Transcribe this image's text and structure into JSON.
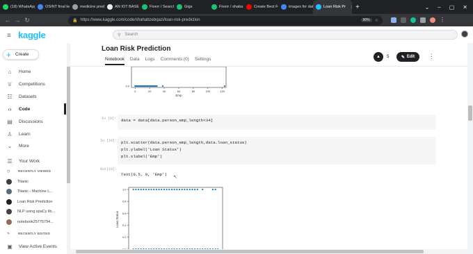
{
  "browser": {
    "tabs": [
      {
        "label": "(18) WhatsApp",
        "color": "#25d366"
      },
      {
        "label": "OSINT final kedaa",
        "color": "#4285f4"
      },
      {
        "label": "medicine pred",
        "color": "#9aa0a6"
      },
      {
        "label": "AN IOT BASED",
        "color": "#e8eaed"
      },
      {
        "label": "Fiverr / Search",
        "color": "#1dbf73"
      },
      {
        "label": "Gigs",
        "color": "#1dbf73"
      },
      {
        "label": "Fiverr / shaba",
        "color": "#1dbf73"
      },
      {
        "label": "Create Best Fo",
        "color": "#ff0000"
      },
      {
        "label": "images for dat",
        "color": "#4285f4"
      },
      {
        "label": "Loan Risk Pr",
        "color": "#20beff",
        "active": true
      }
    ],
    "new_tab": "+",
    "url": "https://www.kaggle.com/code/shahabzebqazi/loan-risk-prediction",
    "zoom": "90%"
  },
  "header": {
    "logo": "kaggle",
    "search_placeholder": "Search"
  },
  "sidebar": {
    "create_label": "Create",
    "items": [
      {
        "label": "Home",
        "icon": "home-icon",
        "glyph": "⌂"
      },
      {
        "label": "Competitions",
        "icon": "trophy-icon",
        "glyph": "♕"
      },
      {
        "label": "Datasets",
        "icon": "database-icon",
        "glyph": "☷"
      },
      {
        "label": "Code",
        "icon": "code-icon",
        "glyph": "‹›",
        "active": true
      },
      {
        "label": "Discussions",
        "icon": "comments-icon",
        "glyph": "▤"
      },
      {
        "label": "Learn",
        "icon": "school-icon",
        "glyph": "♙"
      },
      {
        "label": "More",
        "icon": "chevron-down-icon",
        "glyph": "⌄"
      }
    ],
    "your_work": "Your Work",
    "recently_viewed_label": "RECENTLY VIEWED",
    "recently_viewed": [
      {
        "label": "Titanic",
        "color": "#3c4043"
      },
      {
        "label": "Titanic - Machine L...",
        "color": "#546e7a"
      },
      {
        "label": "Loan Risk Prediction",
        "color": "#202124"
      },
      {
        "label": "NLP using spaCy lib...",
        "color": "#424242"
      },
      {
        "label": "notebook25775794...",
        "color": "#8d6e63"
      }
    ],
    "recently_edited_label": "RECENTLY EDITED",
    "view_active_events": "View Active Events"
  },
  "notebook": {
    "title": "Loan Risk Prediction",
    "tabs": [
      "Notebook",
      "Data",
      "Logs",
      "Comments (0)",
      "Settings"
    ],
    "selected_tab": "Notebook",
    "vote_count": "5",
    "edit_label": "Edit",
    "cells": [
      {
        "prompt": "In [9]:",
        "code": "data = data[data.person_emp_length<34]"
      },
      {
        "prompt": "In [10]:",
        "code": "plt.scatter(data.person_emp_length,data.loan_status)\nplt.ylabel('Loan Status')\nplt.xlabel('Emp')"
      }
    ],
    "output": {
      "prompt": "Out[10]:",
      "text": "Text(0.5, 0, 'Emp')"
    }
  },
  "chart_data": [
    {
      "type": "scatter",
      "xlabel": "Emp",
      "ylabel": "",
      "x_ticks": [
        "0",
        "20",
        "40",
        "60",
        "80",
        "100",
        "120"
      ],
      "y_ticks": [
        "0.0"
      ],
      "xlim": [
        -5,
        125
      ],
      "ylim": [
        0,
        1
      ],
      "points_y0": [
        0,
        1,
        2,
        3,
        4,
        5,
        6,
        7,
        8,
        9,
        10,
        11,
        12,
        13,
        14,
        15,
        16,
        17,
        18,
        19,
        20,
        21,
        22,
        23,
        24,
        25,
        26,
        27,
        28,
        29,
        30,
        38,
        123
      ]
    },
    {
      "type": "scatter",
      "xlabel": "",
      "ylabel": "Loan Status",
      "y_ticks": [
        "1.0",
        "0.8",
        "0.6",
        "0.4",
        "0.2",
        "0.0"
      ],
      "ylim": [
        0,
        1
      ],
      "xlim": [
        -1,
        34
      ],
      "points_y1": [
        0,
        1,
        2,
        3,
        4,
        5,
        6,
        7,
        8,
        9,
        10,
        11,
        12,
        13,
        14,
        15,
        16,
        17,
        18,
        19,
        20,
        21,
        22,
        23,
        24,
        25,
        27,
        31,
        32
      ],
      "points_y0": [
        0,
        1,
        2,
        3,
        4,
        5,
        6,
        7,
        8,
        9,
        10,
        11,
        12,
        13,
        14,
        15,
        16,
        17,
        18,
        19,
        20,
        21,
        22,
        23,
        24,
        25,
        26,
        27,
        28,
        29,
        30,
        31,
        32,
        33
      ]
    }
  ]
}
